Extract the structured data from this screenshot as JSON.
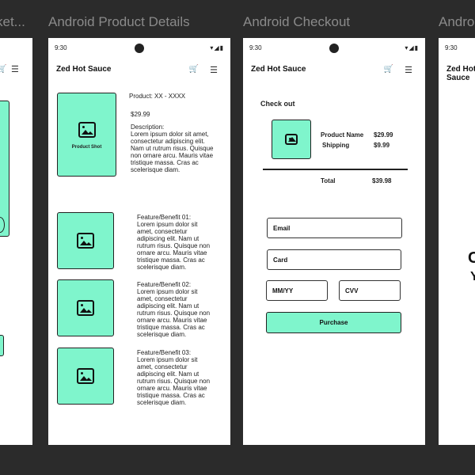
{
  "frames": {
    "left": {
      "title": "…ket..."
    },
    "product": {
      "title": "Android Product Details"
    },
    "checkout": {
      "title": "Android Checkout"
    },
    "right": {
      "title": "Andro"
    }
  },
  "status": {
    "time": "9:30",
    "icons": "▾◢▮"
  },
  "brand": "Zed Hot Sauce",
  "icons": {
    "cart": "cart-icon",
    "menu": "menu-icon",
    "image": "image-placeholder-icon"
  },
  "product": {
    "shot_label": "Product Shot",
    "name": "Product: XX - XXXX",
    "price": "$29.99",
    "description_label": "Description:",
    "description": "Lorem ipsum dolor sit amet, consectetur adipiscing elit. Nam ut rutrum risus. Quisque non ornare arcu. Mauris vitae tristique massa. Cras ac scelerisque diam.",
    "features": [
      {
        "title": "Feature/Benefit 01:",
        "text": "Lorem ipsum dolor sit amet, consectetur adipiscing elit. Nam ut rutrum risus. Quisque non ornare arcu. Mauris vitae tristique massa. Cras ac scelerisque diam."
      },
      {
        "title": "Feature/Benefit 02:",
        "text": "Lorem ipsum dolor sit amet, consectetur adipiscing elit. Nam ut rutrum risus. Quisque non ornare arcu. Mauris vitae tristique massa. Cras ac scelerisque diam."
      },
      {
        "title": "Feature/Benefit 03:",
        "text": "Lorem ipsum dolor sit amet, consectetur adipiscing elit. Nam ut rutrum risus. Quisque non ornare arcu. Mauris vitae tristique massa. Cras ac scelerisque diam."
      }
    ]
  },
  "checkout": {
    "heading": "Check out",
    "product_name_label": "Product Name",
    "product_price": "$29.99",
    "shipping_label": "Shipping",
    "shipping_price": "$9.99",
    "total_label": "Total",
    "total_price": "$39.98",
    "email_label": "Email",
    "card_label": "Card",
    "mmyy_label": "MM/YY",
    "cvv_label": "CVV",
    "purchase_label": "Purchase"
  },
  "right_partial": {
    "line1": "C",
    "line2": "Y"
  },
  "colors": {
    "accent": "#7ff5cc",
    "background": "#2b2b2b",
    "frame": "#ffffff"
  }
}
